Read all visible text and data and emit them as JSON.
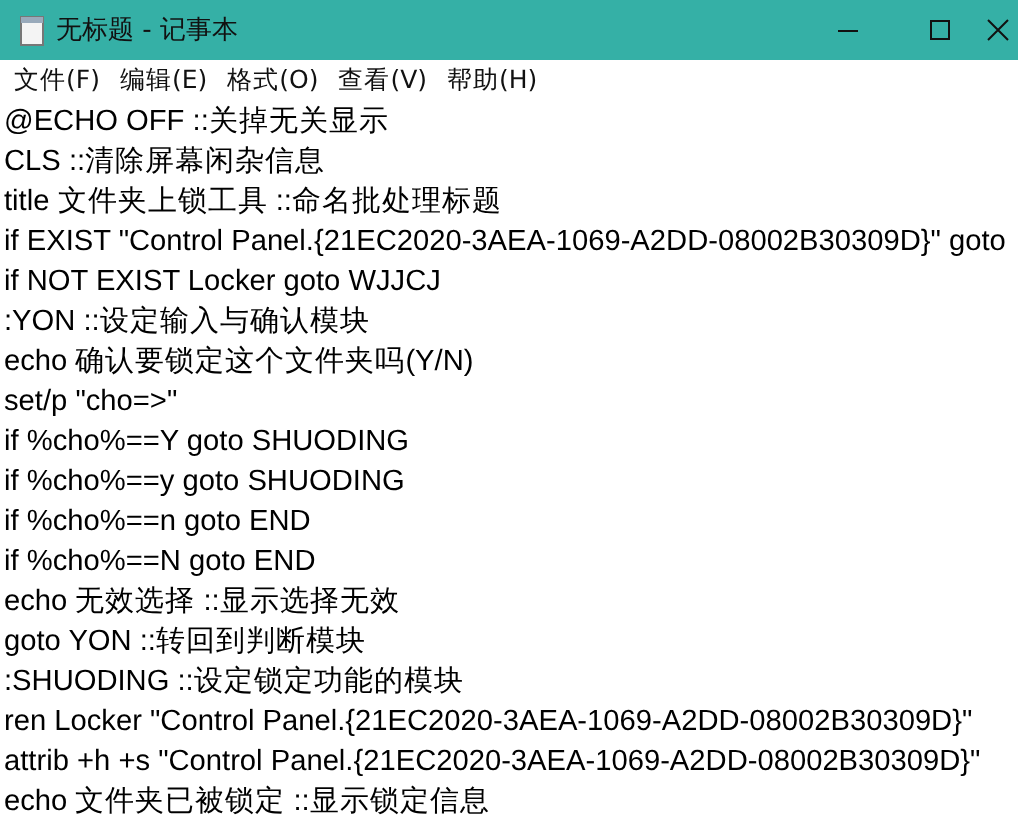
{
  "window": {
    "title": "无标题 - 记事本"
  },
  "menu": [
    {
      "label": "文件(F)"
    },
    {
      "label": "编辑(E)"
    },
    {
      "label": "格式(O)"
    },
    {
      "label": "查看(V)"
    },
    {
      "label": "帮助(H)"
    }
  ],
  "lines": [
    "@ECHO OFF ::关掉无关显示",
    "CLS ::清除屏幕闲杂信息",
    "title 文件夹上锁工具 ::命名批处理标题",
    "if EXIST \"Control Panel.{21EC2020-3AEA-1069-A2DD-08002B30309D}\" goto",
    "if NOT EXIST Locker goto WJJCJ",
    ":YON ::设定输入与确认模块",
    "echo 确认要锁定这个文件夹吗(Y/N)",
    "set/p \"cho=>\"",
    "if %cho%==Y goto SHUODING",
    "if %cho%==y goto SHUODING",
    "if %cho%==n goto END",
    "if %cho%==N goto END",
    "echo 无效选择 ::显示选择无效",
    "goto YON ::转回到判断模块",
    ":SHUODING ::设定锁定功能的模块",
    "ren Locker \"Control Panel.{21EC2020-3AEA-1069-A2DD-08002B30309D}\"",
    "attrib +h +s \"Control Panel.{21EC2020-3AEA-1069-A2DD-08002B30309D}\"",
    "echo 文件夹已被锁定 ::显示锁定信息"
  ]
}
